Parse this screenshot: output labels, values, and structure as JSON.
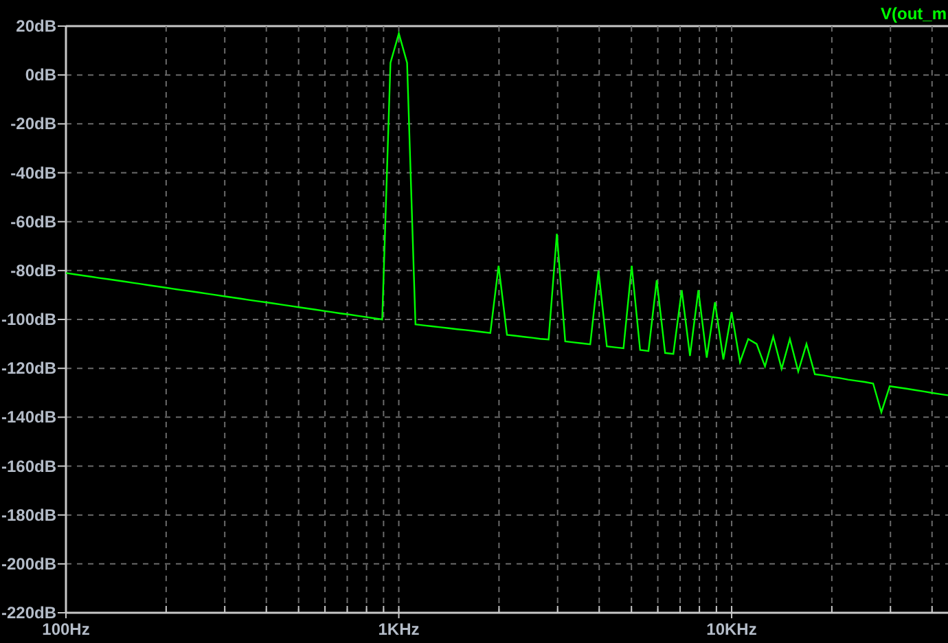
{
  "plot": {
    "chart_data": {
      "type": "line",
      "grid": true,
      "ylim": [
        -220,
        20
      ],
      "yticks": [
        {
          "value": 20,
          "label": "20dB"
        },
        {
          "value": 0,
          "label": "0dB"
        },
        {
          "value": -20,
          "label": "-20dB"
        },
        {
          "value": -40,
          "label": "-40dB"
        },
        {
          "value": -60,
          "label": "-60dB"
        },
        {
          "value": -80,
          "label": "-80dB"
        },
        {
          "value": -100,
          "label": "-100dB"
        },
        {
          "value": -120,
          "label": "-120dB"
        },
        {
          "value": -140,
          "label": "-140dB"
        },
        {
          "value": -160,
          "label": "-160dB"
        },
        {
          "value": -180,
          "label": "-180dB"
        },
        {
          "value": -200,
          "label": "-200dB"
        },
        {
          "value": -220,
          "label": "-220dB"
        }
      ],
      "categories": [
        "100Hz",
        null,
        null,
        null,
        null,
        null,
        null,
        null,
        null,
        null,
        null,
        null,
        null,
        null,
        null,
        null,
        null,
        null,
        null,
        null,
        null,
        null,
        null,
        null,
        null,
        null,
        null,
        null,
        null,
        null,
        null,
        null,
        null,
        null,
        null,
        null,
        null,
        null,
        null,
        null,
        "1KHz",
        null,
        null,
        null,
        null,
        null,
        null,
        null,
        null,
        null,
        null,
        null,
        null,
        null,
        null,
        null,
        null,
        null,
        null,
        null,
        null,
        null,
        null,
        null,
        null,
        null,
        null,
        null,
        null,
        null,
        null,
        null,
        null,
        null,
        null,
        null,
        null,
        null,
        null,
        null,
        "10KHz",
        null,
        null,
        null,
        null,
        null,
        null,
        null,
        null,
        null,
        null,
        null,
        null,
        null,
        null,
        null,
        null,
        null,
        null,
        null,
        null,
        null,
        null,
        null,
        null,
        null,
        null
      ],
      "series": [
        {
          "name": "V(out_m",
          "color": "#00ff00",
          "values": [
            -81,
            -81.5,
            -82,
            -82.5,
            -83,
            -83.5,
            -84,
            -84.5,
            -85,
            -85.5,
            -86,
            -86.5,
            -87,
            -87.5,
            -88,
            -88.5,
            -89,
            -89.5,
            -90,
            -90.5,
            -91,
            -91.5,
            -92,
            -92.5,
            -93,
            -93.5,
            -94,
            -94.5,
            -95,
            -95.5,
            -96,
            -96.5,
            -97,
            -97.5,
            -98,
            -98.5,
            -99,
            -99.5,
            -100,
            5,
            17,
            5,
            -102,
            -102.4,
            -102.8,
            -103.2,
            -103.6,
            -104,
            -104.3,
            -104.7,
            -105.1,
            -105.5,
            -78,
            -106.3,
            -106.7,
            -107.1,
            -107.5,
            -107.9,
            -108.2,
            -65,
            -109,
            -109.4,
            -109.8,
            -110.2,
            -80,
            -111,
            -111.4,
            -111.8,
            -78,
            -112.5,
            -112.9,
            -84,
            -113.7,
            -114.1,
            -88,
            -114.9,
            -88,
            -115.6,
            -93,
            -116.4,
            -97,
            -117.5,
            -108,
            -110,
            -119.2,
            -107,
            -120.2,
            -108,
            -121.3,
            -110,
            -122.4,
            -122.9,
            -123.5,
            -124,
            -124.6,
            -125.1,
            -125.6,
            -126.2,
            -138,
            -127.3,
            -127.8,
            -128.3,
            -128.9,
            -129.4,
            -130,
            -130.5,
            -131
          ]
        }
      ]
    }
  }
}
